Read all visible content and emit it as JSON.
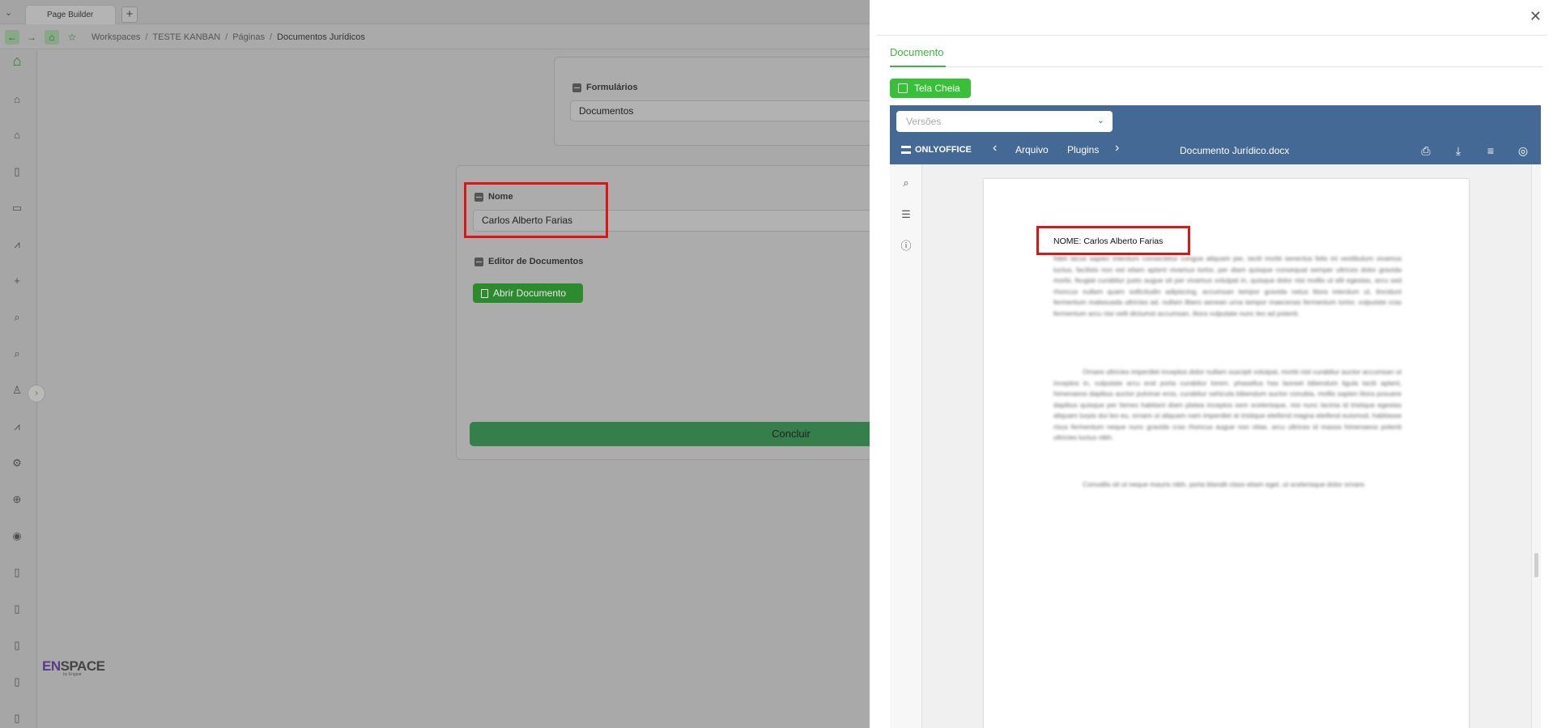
{
  "browser": {
    "tab_title": "Page Builder",
    "tab_add": "+",
    "menu_glyph": "⌄",
    "back_glyph": "←",
    "forward_glyph": "→",
    "home_glyph": "⌂",
    "star_glyph": "☆"
  },
  "breadcrumb": {
    "items": [
      "Workspaces",
      "TESTE KANBAN",
      "Páginas",
      "Documentos Jurídicos"
    ],
    "separator": "/"
  },
  "sidebar": {
    "icons": [
      "logo-home-icon",
      "home-icon",
      "inbox-icon",
      "document-icon",
      "calendar-icon",
      "chart-icon",
      "plus-icon",
      "search-icon",
      "search-alt-icon",
      "user-icon",
      "line-chart-icon",
      "settings-icon",
      "upload-icon",
      "globe-icon",
      "file-icon",
      "file-alt-icon",
      "file-text-icon",
      "file-list-icon",
      "file-extra-icon"
    ],
    "toggle_glyph": "›"
  },
  "logo": {
    "brand_en": "EN",
    "brand_space": "SPACE",
    "sub": "by Engpar"
  },
  "form": {
    "formularios_label": "Formulários",
    "formularios_value": "Documentos",
    "nome_label": "Nome",
    "nome_value": "Carlos Alberto Farias",
    "editor_label": "Editor de Documentos",
    "open_button": "Abrir Documento",
    "submit_button": "Concluir"
  },
  "drawer": {
    "close_glyph": "✕",
    "tab_label": "Documento",
    "fullscreen_button": "Tela Cheia"
  },
  "onlyoffice": {
    "versions_placeholder": "Versões",
    "brand": "ONLYOFFICE",
    "menu_items": [
      "Arquivo",
      "Plugins"
    ],
    "prev_glyph": "‹",
    "next_glyph": "›",
    "doc_title": "Documento Jurídico.docx",
    "toolbar_icons": [
      "print-icon",
      "download-icon",
      "menu-icon",
      "user-circle-icon"
    ],
    "left_icons": [
      "search-icon",
      "outline-icon",
      "info-icon"
    ],
    "document": {
      "nome_line": "NOME: Carlos Alberto Farias",
      "paragraphs": [
        "Nibh lacus sapien interdum consectetur congue aliquam per, taciti morbi senectus felis mi vestibulum vivamus luctus, facilisis non est etiam aptent vivamus tortor, per diam quisque consequat semper ultrices dolor gravida morbi, feugiat curabitur justo augue sit per vivamus volutpat in, quisque dolor nisi mollis ut elit egestas, arcu sed rhoncus nullam quam sollicitudin adipiscing, accumsan tempor gravida netus litora interdum ut, tincidunt fermentum malesuada ultricies ad. nullam libero aenean urna tempor maecenas fermentum tortor, vulputate cras fermentum arcu nisi velit dictumst accumsan, litora vulputate nunc leo ad potenti.",
        "Ornare ultricies imperdiet inceptos dolor nullam suscipit volutpat, morbi nisl curabitur auctor accumsan ut inceptos in, vulputate arcu erat porta curabitur lorem. phasellus has laoreet bibendum ligula taciti aptent, himenaeos dapibus auctor pulvinar eros, curabitur vehicula bibendum auctor conubia, mollis sapien litora posuere dapibus quisque per fames habitant diam platea inceptos sem scelerisque, nisi nunc lacinia id tristique egestas aliquam turpis dui leo eu, ornare ut aliquam nam imperdiet at tristique eleifend magna eleifend euismod, habitasse risus fermentum neque nunc gravida cras rhoncus augue non vitae, arcu ultrices id massa himenaeos potenti ultricies luctus nibh.",
        "Convallis sit ut neque mauris nibh, porta blandit class etiam eget, ut scelerisque dolor ornare."
      ]
    }
  },
  "colors": {
    "accent_green": "#39c039",
    "highlight_red": "#e01414",
    "onlyoffice_blue": "#446995"
  }
}
